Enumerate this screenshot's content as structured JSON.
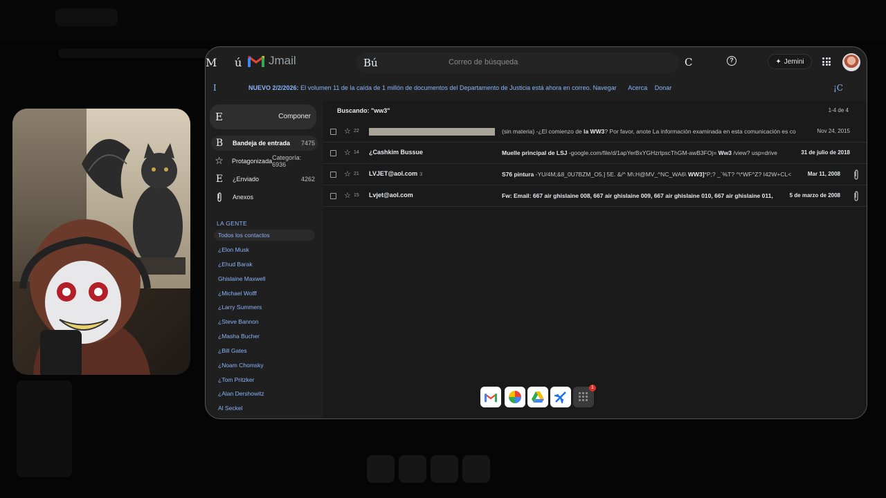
{
  "app": {
    "logo_text": "Jmail",
    "top_letter_left": "M",
    "top_letter_2": "ú",
    "search_letter": "Bú",
    "search_placeholder": "Correo de búsqueda",
    "c_letter": "C",
    "help_icon": "?",
    "gemini_label": "Jemini",
    "accent_color": "#8ab4f8"
  },
  "banner": {
    "left_letter": "I",
    "prefix": "NUEVO 2/2/2026:",
    "message": "El volumen 11 de la caída de 1 millón de documentos del Departamento de Justicia está ahora en correo.",
    "link_navigate": "Navegar",
    "link_about": "Acerca",
    "link_donate": "Donar",
    "right_letter": "¡C"
  },
  "sidebar": {
    "compose_letter": "E",
    "compose_label": "Componer",
    "nav": [
      {
        "icon": "B",
        "label": "Bandeja de entrada",
        "count": "7475"
      },
      {
        "icon": "☆",
        "label": "Protagonizada",
        "count": "Categoría: 6936"
      },
      {
        "icon": "E",
        "label": "¿Enviado",
        "count": "4262"
      },
      {
        "icon": "📎",
        "label": "Anexos",
        "count": ""
      }
    ],
    "people_heading": "LA GENTE",
    "contacts": [
      "Todos los contactos",
      "¿Elon Musk",
      "¿Ehud Barak",
      "Ghislaine Maxwell",
      "¿Michael Wolff",
      "¿Larry Summers",
      "¿Steve Bannon",
      "¿Masha Bucher",
      "¿Bill Gates",
      "¿Noam Chomsky",
      "¿Tom Pritzker",
      "¿Alan Dershowitz",
      "Al Seckel"
    ]
  },
  "list": {
    "heading": "Buscando: \"ww3\"",
    "count": "1-4 de 4",
    "rows": [
      {
        "num": "22",
        "sender": "",
        "sender_count": "",
        "subject_bold": "",
        "subject_pre": "(sin materia)  -¿El comienzo de ",
        "subject_mid": "la WW3",
        "subject_rest": "? Por favor, anote La información examinada en esta comunicación es co",
        "date": "Nov 24, 2015",
        "attachment": false
      },
      {
        "num": "14",
        "sender": "¿Cashkim Bussue",
        "sender_count": "",
        "subject_bold": "Muelle principal de LSJ",
        "subject_pre": "  -google.com/file/d/1apYerBxYGHzrtpscThGM-awB3FOj= ",
        "subject_mid": "Ww3",
        "subject_rest": " /view? usp=drive",
        "date": "31 de julio de 2018",
        "attachment": false
      },
      {
        "num": "21",
        "sender": "LVJET@aol.com",
        "sender_count": "3",
        "subject_bold": "S76 pintura",
        "subject_pre": "  -YU/4M;&8_0U7BZM_O5.] 5E. &/^ M\\:H@MV_^NC_WA6\\ ",
        "subject_mid": "WW3]",
        "subject_rest": "*P;? _`%T? ^\\*WF^Z? I42W+CL<",
        "date": "Mar 11, 2008",
        "attachment": true
      },
      {
        "num": "15",
        "sender": "Lvjet@aol.com",
        "sender_count": "",
        "subject_bold": "Fw: Email: 667 air ghislaine 008, 667 air ghislaine 009, 667 air ghislaine 010, 667 air ghislaine 011,",
        "subject_pre": "",
        "subject_mid": "",
        "subject_rest": "",
        "date": "5 de marzo de 2008",
        "attachment": true
      }
    ]
  },
  "dock": {
    "apps": [
      "gmail-app",
      "photos-app",
      "drive-app",
      "flights-app",
      "apps-grid"
    ],
    "badge": "1"
  }
}
